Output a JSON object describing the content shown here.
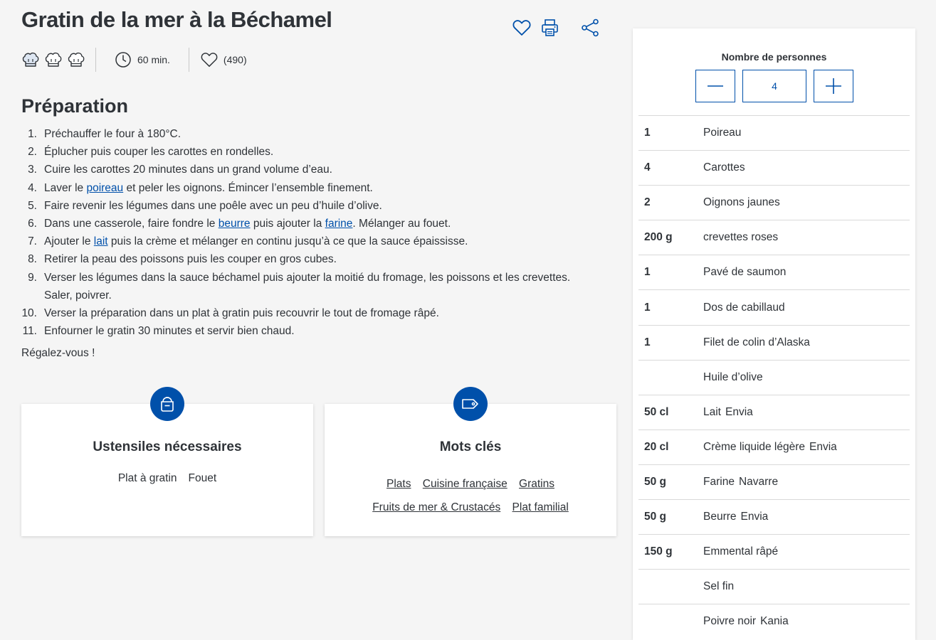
{
  "title": "Gratin de la mer à la Béchamel",
  "actions": {
    "favorite_icon": "heart-icon",
    "print_icon": "printer-icon",
    "share_icon": "share-icon"
  },
  "meta": {
    "difficulty_icon": "chef-hat-icon",
    "time": "60 min.",
    "likes": "(490)"
  },
  "preparation": {
    "heading": "Préparation",
    "steps": [
      {
        "num": "1.",
        "parts": [
          {
            "t": "Préchauffer le four à 180°C."
          }
        ]
      },
      {
        "num": "2.",
        "parts": [
          {
            "t": "Éplucher puis couper les carottes en rondelles."
          }
        ]
      },
      {
        "num": "3.",
        "parts": [
          {
            "t": "Cuire les carottes 20 minutes dans un grand volume d’eau."
          }
        ]
      },
      {
        "num": "4.",
        "parts": [
          {
            "t": "Laver le "
          },
          {
            "t": "poireau",
            "link": true
          },
          {
            "t": " et peler les oignons. Émincer l’ensemble finement."
          }
        ]
      },
      {
        "num": "5.",
        "parts": [
          {
            "t": "Faire revenir les légumes dans une poêle avec un peu d’huile d’olive."
          }
        ]
      },
      {
        "num": "6.",
        "parts": [
          {
            "t": "Dans une casserole, faire fondre le "
          },
          {
            "t": "beurre",
            "link": true
          },
          {
            "t": " puis ajouter la "
          },
          {
            "t": "farine",
            "link": true
          },
          {
            "t": ". Mélanger au fouet."
          }
        ]
      },
      {
        "num": "7.",
        "parts": [
          {
            "t": "Ajouter le "
          },
          {
            "t": "lait",
            "link": true
          },
          {
            "t": " puis la crème et mélanger en continu jusqu’à ce que la sauce épaississe."
          }
        ]
      },
      {
        "num": "8.",
        "parts": [
          {
            "t": "Retirer la peau des poissons puis les couper en gros cubes."
          }
        ]
      },
      {
        "num": "9.",
        "parts": [
          {
            "t": "Verser les légumes dans la sauce béchamel puis ajouter la moitié du fromage, les poissons et les crevettes. Saler, poivrer."
          }
        ]
      },
      {
        "num": "10.",
        "parts": [
          {
            "t": "Verser la préparation dans un plat à gratin puis recouvrir le tout de fromage râpé."
          }
        ]
      },
      {
        "num": "11.",
        "parts": [
          {
            "t": "Enfourner le gratin 30 minutes et servir bien chaud."
          }
        ]
      }
    ],
    "closing": "Régalez-vous !"
  },
  "utensils": {
    "title": "Ustensiles nécessaires",
    "icon": "pot-icon",
    "items": [
      "Plat à gratin",
      "Fouet"
    ]
  },
  "keywords": {
    "title": "Mots clés",
    "icon": "tag-icon",
    "rows": [
      [
        "Plats",
        "Cuisine française",
        "Gratins"
      ],
      [
        "Fruits de mer & Crustacés",
        "Plat familial"
      ]
    ]
  },
  "servings": {
    "label": "Nombre de personnes",
    "value": "4",
    "decrement_icon": "minus-icon",
    "increment_icon": "plus-icon"
  },
  "ingredients": [
    {
      "qty": "1",
      "name": "Poireau",
      "brand": ""
    },
    {
      "qty": "4",
      "name": "Carottes",
      "brand": ""
    },
    {
      "qty": "2",
      "name": "Oignons jaunes",
      "brand": ""
    },
    {
      "qty": "200 g",
      "name": "crevettes roses",
      "brand": ""
    },
    {
      "qty": "1",
      "name": "Pavé de saumon",
      "brand": ""
    },
    {
      "qty": "1",
      "name": "Dos de cabillaud",
      "brand": ""
    },
    {
      "qty": "1",
      "name": "Filet de colin d’Alaska",
      "brand": ""
    },
    {
      "qty": "",
      "name": "Huile d’olive",
      "brand": ""
    },
    {
      "qty": "50 cl",
      "name": "Lait",
      "brand": "Envia"
    },
    {
      "qty": "20 cl",
      "name": "Crème liquide légère",
      "brand": "Envia"
    },
    {
      "qty": "50 g",
      "name": "Farine",
      "brand": "Navarre"
    },
    {
      "qty": "50 g",
      "name": "Beurre",
      "brand": "Envia"
    },
    {
      "qty": "150 g",
      "name": "Emmental râpé",
      "brand": ""
    },
    {
      "qty": "",
      "name": "Sel fin",
      "brand": ""
    },
    {
      "qty": "",
      "name": "Poivre noir",
      "brand": "Kania"
    }
  ],
  "colors": {
    "accent": "#0050aa",
    "text": "#2f3338",
    "background": "#f5f5f5"
  }
}
